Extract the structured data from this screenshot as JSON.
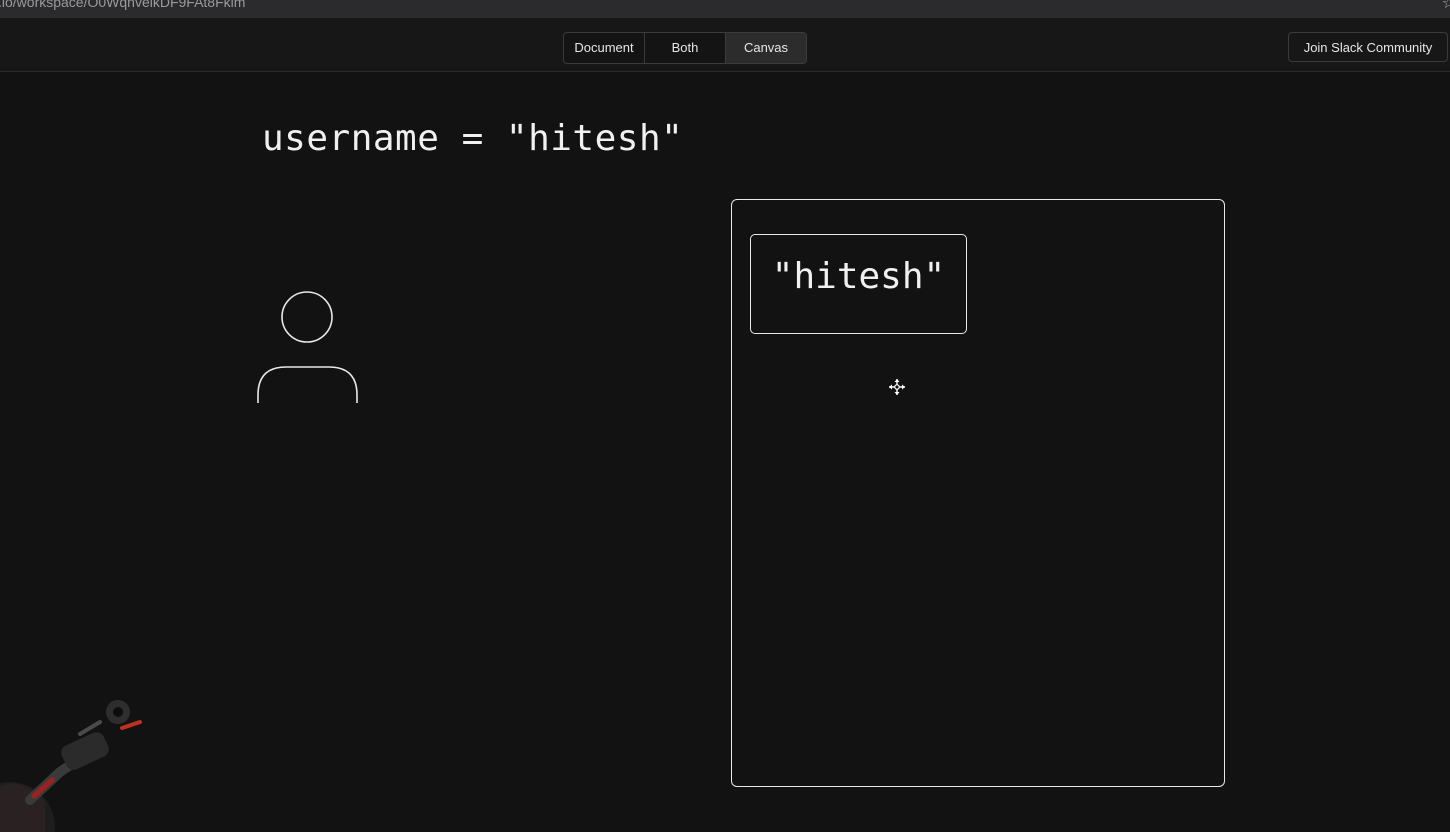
{
  "browser": {
    "url": ".io/workspace/O0WqnvelkDF9FAt8Fkim"
  },
  "toolbar": {
    "view_modes": [
      {
        "label": "Document",
        "active": false
      },
      {
        "label": "Both",
        "active": false
      },
      {
        "label": "Canvas",
        "active": true
      }
    ],
    "slack_button": "Join Slack Community"
  },
  "canvas": {
    "code_text": "username = \"hitesh\"",
    "value_text": "\"hitesh\"",
    "icons": [
      "person-icon",
      "move-cursor-icon"
    ]
  },
  "colors": {
    "background": "#131313",
    "stroke": "#e8e8e8",
    "active_segment": "#2c2c2c"
  }
}
